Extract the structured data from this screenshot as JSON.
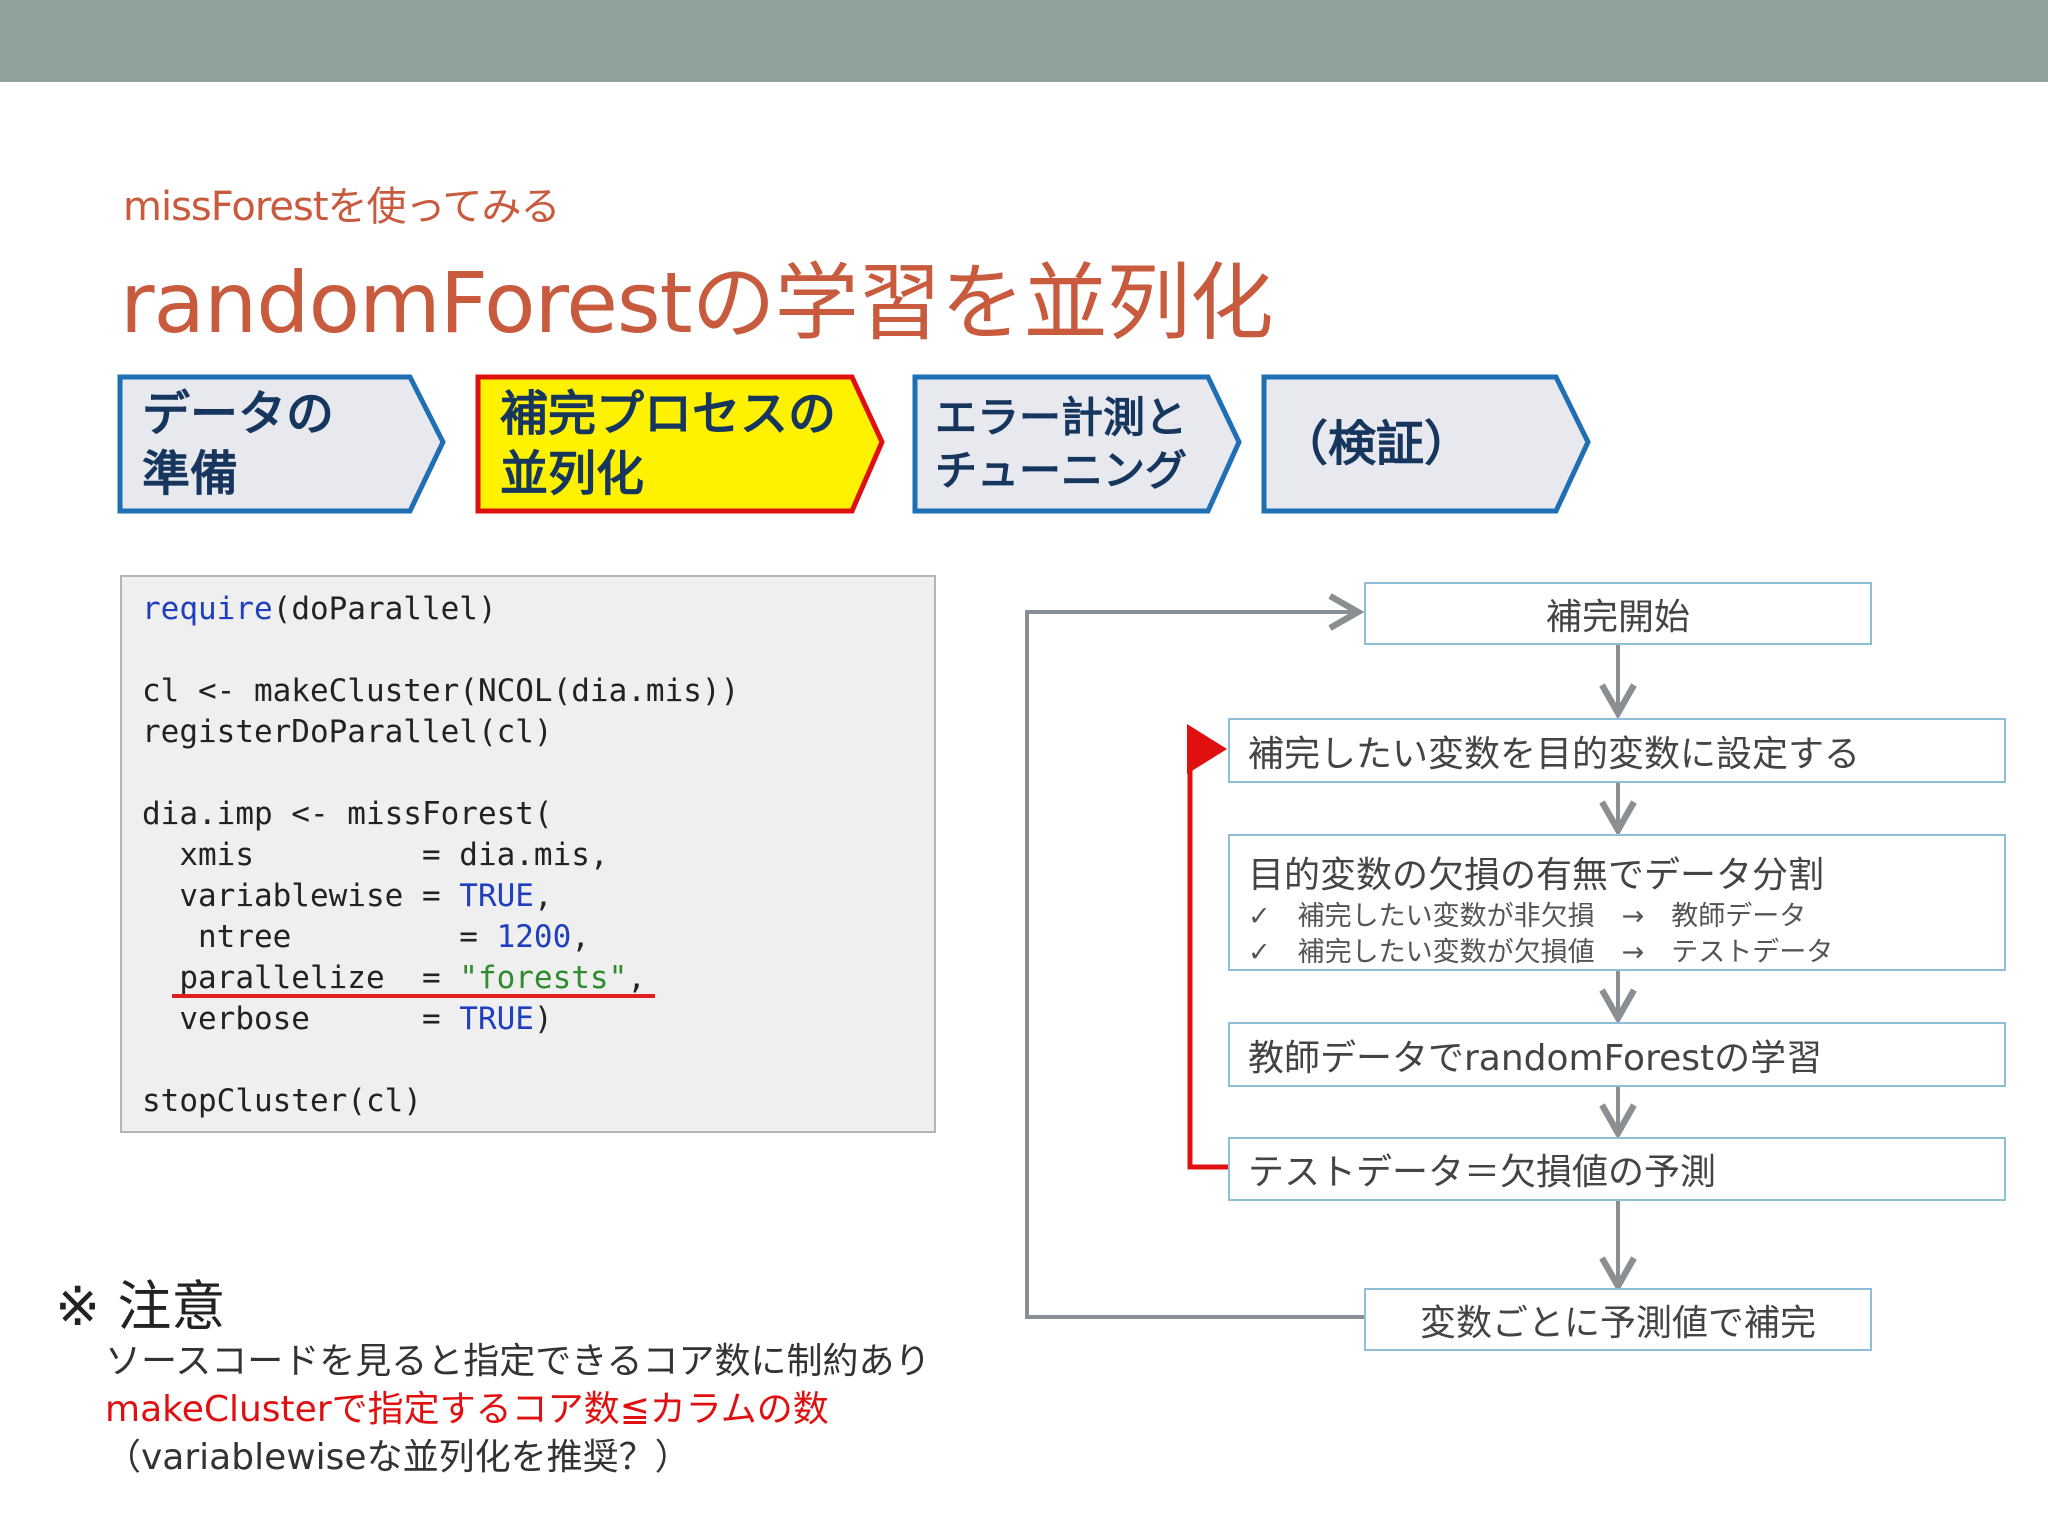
{
  "header": {
    "subtitle": "missForestを使ってみる",
    "title": "randomForestの学習を並列化"
  },
  "steps": [
    {
      "line1": "データの",
      "line2": "準備",
      "highlighted": false
    },
    {
      "line1": "補完プロセスの",
      "line2": "並列化",
      "highlighted": true
    },
    {
      "line1": "エラー計測と",
      "line2": "チューニング",
      "highlighted": false
    },
    {
      "line1": "（検証）",
      "line2": "",
      "highlighted": false
    }
  ],
  "code": {
    "line1_kw": "require",
    "line1_rest": "(doParallel)",
    "line2": "cl <- makeCluster(NCOL(dia.mis))",
    "line3": "registerDoParallel(cl)",
    "line4": "dia.imp <- missForest(",
    "line5": "  xmis         = dia.mis,",
    "line6_a": "  variablewise = ",
    "line6_v": "TRUE",
    "line6_b": ",",
    "line7_a": "   ntree         = ",
    "line7_v": "1200",
    "line7_b": ",",
    "line8_a": "  parallelize  = ",
    "line8_v": "\"forests\"",
    "line8_b": ",",
    "line9_a": "  verbose      = ",
    "line9_v": "TRUE",
    "line9_b": ")",
    "line10": "stopCluster(cl)"
  },
  "flow": {
    "start": "補完開始",
    "set_target": "補完したい変数を目的変数に設定する",
    "split_title": "目的変数の欠損の有無でデータ分割",
    "split_item1": "✓　補完したい変数が非欠損　→　教師データ",
    "split_item2": "✓　補完したい変数が欠損値　→　テストデータ",
    "train": "教師データでrandomForestの学習",
    "predict": "テストデータ＝欠損値の予測",
    "impute": "変数ごとに予測値で補完"
  },
  "note": {
    "title": "※ 注意",
    "line1": "ソースコードを見ると指定できるコア数に制約あり",
    "line2": "makeClusterで指定するコア数≦カラムの数",
    "line3": "（variablewiseな並列化を推奨？）"
  },
  "colors": {
    "title": "#c85a3e",
    "topbar": "#8fa29a",
    "step_border": "#1f6fb5",
    "step_fill": "#e8e9ef",
    "highlight_fill": "#fff200",
    "highlight_border": "#e01010",
    "loop_red": "#e01010",
    "flow_arrow": "#8a8f93"
  }
}
